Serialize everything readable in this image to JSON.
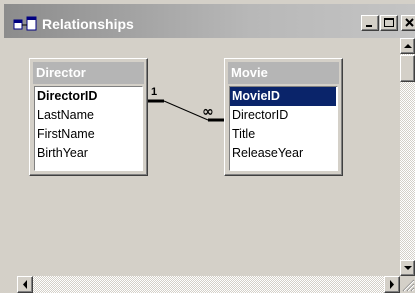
{
  "window": {
    "title": "Relationships",
    "icon": "relationships-window-icon"
  },
  "controls": {
    "minimize_icon": "minimize-icon",
    "maximize_icon": "maximize-icon",
    "close_icon": "close-icon"
  },
  "tables": [
    {
      "name": "Director",
      "fields": [
        "DirectorID",
        "LastName",
        "FirstName",
        "BirthYear"
      ],
      "primary_key": "DirectorID"
    },
    {
      "name": "Movie",
      "fields": [
        "MovieID",
        "DirectorID",
        "Title",
        "ReleaseYear"
      ],
      "primary_key": "MovieID",
      "selected_field": "MovieID"
    }
  ],
  "relationship": {
    "from_table": "Director",
    "from_field": "DirectorID",
    "to_table": "Movie",
    "to_field": "DirectorID",
    "one_label": "1",
    "many_label": "∞"
  },
  "colors": {
    "title_bar_inactive_start": "#8c8c8c",
    "title_bar_inactive_end": "#c4c4c4",
    "selection": "#0a246a",
    "face": "#d4d0c8"
  }
}
